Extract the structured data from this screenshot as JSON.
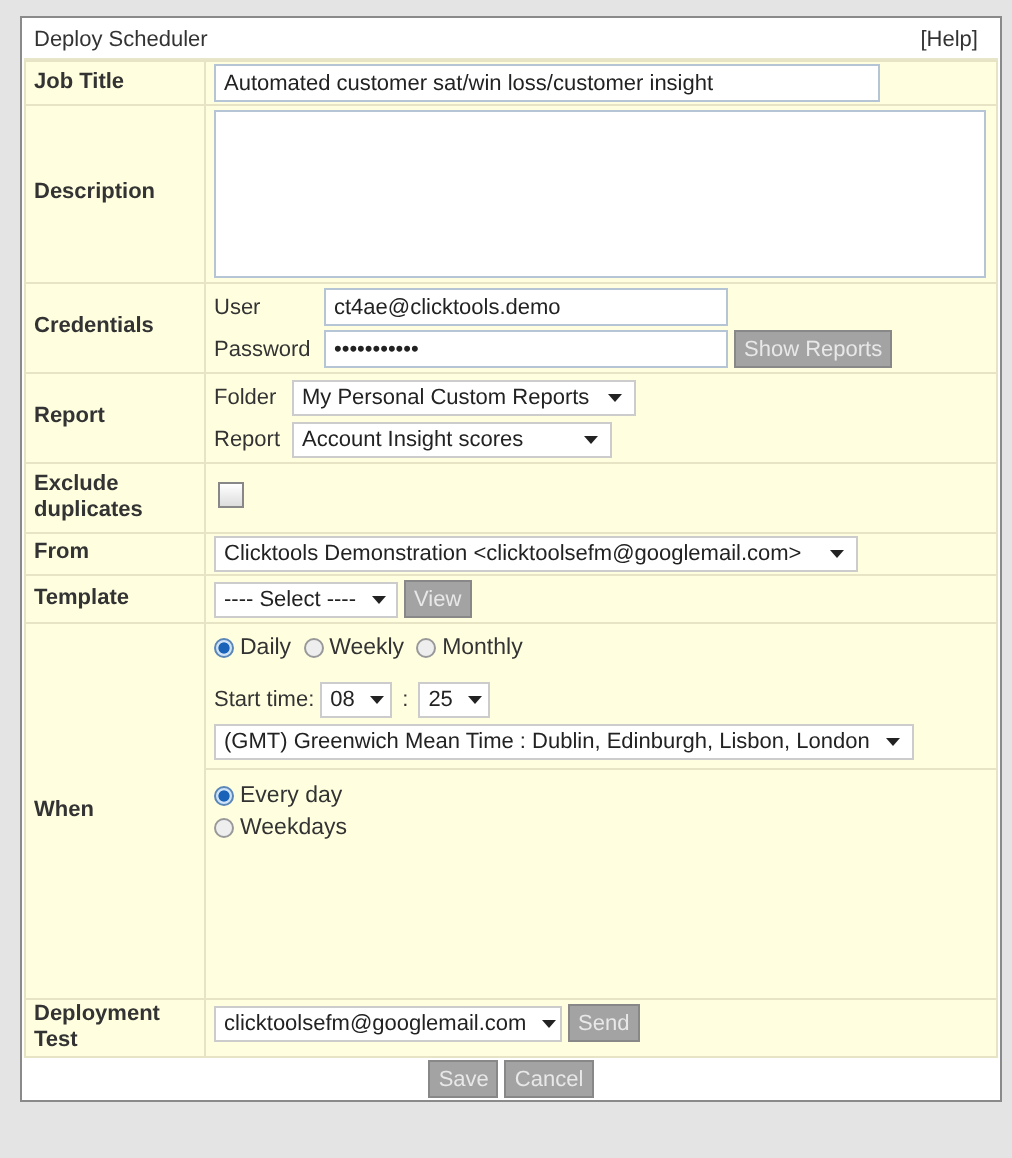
{
  "window": {
    "title": "Deploy Scheduler",
    "help": "[Help]"
  },
  "job_title": {
    "label": "Job Title",
    "value": "Automated customer sat/win loss/customer insight"
  },
  "description": {
    "label": "Description"
  },
  "credentials": {
    "label": "Credentials",
    "user_label": "User",
    "user_value": "ct4ae@clicktools.demo",
    "password_label": "Password",
    "password_value": "•••••••••••",
    "button": "Show Reports"
  },
  "report": {
    "label": "Report",
    "folder_label": "Folder",
    "folder_value": "My Personal Custom Reports",
    "report_label": "Report",
    "report_value": "Account Insight scores"
  },
  "exclude": {
    "label": "Exclude duplicates",
    "checked": false
  },
  "from": {
    "label": "From",
    "value": "Clicktools Demonstration <clicktoolsefm@googlemail.com>"
  },
  "template": {
    "label": "Template",
    "value": "---- Select ----",
    "button": "View"
  },
  "when": {
    "label": "When",
    "frequency": [
      {
        "label": "Daily",
        "selected": true
      },
      {
        "label": "Weekly",
        "selected": false
      },
      {
        "label": "Monthly",
        "selected": false
      }
    ],
    "start_label": "Start time:",
    "hour": "08",
    "separator": ":",
    "minute": "25",
    "timezone": "(GMT) Greenwich Mean Time : Dublin, Edinburgh, Lisbon, London",
    "days": [
      {
        "label": "Every day",
        "selected": true
      },
      {
        "label": "Weekdays",
        "selected": false
      }
    ]
  },
  "deployment_test": {
    "label": "Deployment Test",
    "value": "clicktoolsefm@googlemail.com",
    "button": "Send"
  },
  "actions": [
    "Save",
    "Cancel"
  ]
}
